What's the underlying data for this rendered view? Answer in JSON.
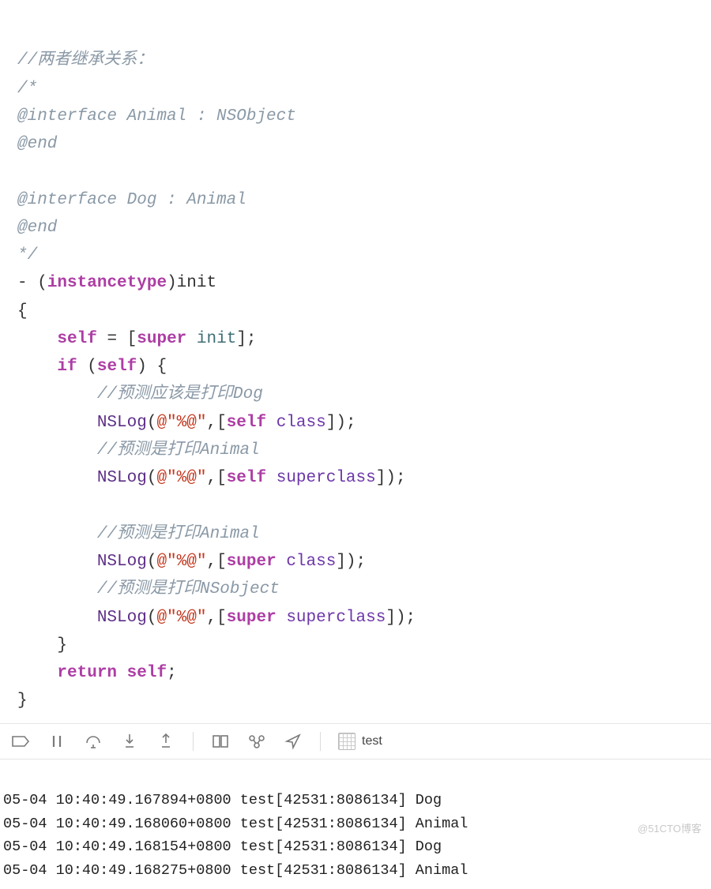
{
  "code": {
    "c1": "//两者继承关系：",
    "c2": "/*",
    "c3": "@interface Animal : NSObject",
    "c4": "@end",
    "c5": "@interface Dog : Animal",
    "c6": "@end",
    "c7": "*/",
    "dash": "-",
    "lp": "(",
    "kw_instancetype": "instancetype",
    "rp": ")",
    "mname": "init",
    "lb": "{",
    "self1": "self",
    "eq": " = [",
    "super1": "super",
    "sp": " ",
    "init_call": "init",
    "close1": "];",
    "if_kw": "if",
    "if_lp": " (",
    "self_if": "self",
    "if_rp": ") {",
    "cc1": "//预测应该是打印Dog",
    "nslog": "NSLog",
    "arg_open": "(",
    "str": "@\"%@\"",
    "comma": ",[",
    "self_m1": "self",
    "class_m": "class",
    "arg_close": "]);",
    "cc2": "//预测是打印Animal",
    "self_m2": "self",
    "superclass_m": "superclass",
    "cc3": "//预测是打印Animal",
    "super_m1": "super",
    "cc4": "//预测是打印NSobject",
    "super_m2": "super",
    "rb_inner": "}",
    "return_kw": "return",
    "self_ret": "self",
    "semi": ";",
    "rb": "}"
  },
  "toolbar": {
    "scheme_name": "test"
  },
  "console": {
    "lines": [
      "05-04 10:40:49.167894+0800 test[42531:8086134] Dog",
      "05-04 10:40:49.168060+0800 test[42531:8086134] Animal",
      "05-04 10:40:49.168154+0800 test[42531:8086134] Dog",
      "05-04 10:40:49.168275+0800 test[42531:8086134] Animal"
    ]
  },
  "watermark": "@51CTO博客"
}
